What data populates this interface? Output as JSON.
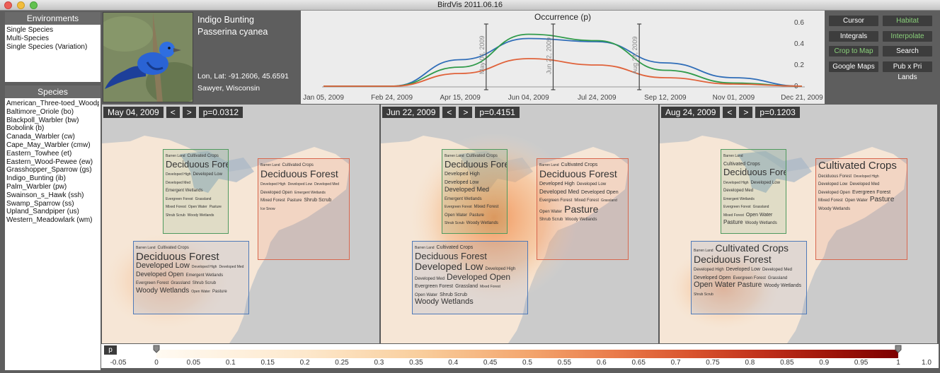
{
  "window": {
    "title": "BirdVis   2011.06.16"
  },
  "environments": {
    "header": "Environments",
    "items": [
      "Single Species",
      "Multi-Species",
      "Single Species (Variation)"
    ]
  },
  "species": {
    "header": "Species",
    "items": [
      "American_Three-toed_Woodp",
      "Baltimore_Oriole (bo)",
      "Blackpoll_Warbler (bw)",
      "Bobolink (b)",
      "Canada_Warbler (cw)",
      "Cape_May_Warbler (cmw)",
      "Eastern_Towhee (et)",
      "Eastern_Wood-Pewee (ew)",
      "Grasshopper_Sparrow (gs)",
      "Indigo_Bunting (ib)",
      "Palm_Warbler (pw)",
      "Swainson_s_Hawk (ssh)",
      "Swamp_Sparrow (ss)",
      "Upland_Sandpiper (us)",
      "Western_Meadowlark (wm)"
    ]
  },
  "bird": {
    "common_name": "Indigo Bunting",
    "latin_name": "Passerina cyanea",
    "coords": "Lon, Lat: -91.2606, 45.6591",
    "location": "Sawyer, Wisconsin"
  },
  "chart_data": {
    "type": "line",
    "title": "Occurrence (p)",
    "x": [
      "2009-01-05",
      "2009-02-24",
      "2009-04-15",
      "2009-06-04",
      "2009-07-24",
      "2009-09-12",
      "2009-11-01",
      "2009-12-21"
    ],
    "x_tick_labels": [
      "Jan 05, 2009",
      "Feb 24, 2009",
      "Apr 15, 2009",
      "Jun 04, 2009",
      "Jul 24, 2009",
      "Sep 12, 2009",
      "Nov 01, 2009",
      "Dec 21, 2009"
    ],
    "ylim": [
      0,
      0.6
    ],
    "y_ticks": [
      "0",
      "0.2",
      "0.4",
      "0.6"
    ],
    "series": [
      {
        "color": "#2f6db8",
        "values": [
          0.0,
          0.0,
          0.25,
          0.45,
          0.42,
          0.22,
          0.08,
          0.0
        ]
      },
      {
        "color": "#2f9a4a",
        "values": [
          0.0,
          0.0,
          0.18,
          0.49,
          0.43,
          0.15,
          0.03,
          0.0
        ]
      },
      {
        "color": "#e0623a",
        "values": [
          0.0,
          0.0,
          0.12,
          0.26,
          0.2,
          0.08,
          0.02,
          0.0
        ]
      }
    ],
    "markers": [
      {
        "x": "2009-05-04",
        "label": "May 04, 2009"
      },
      {
        "x": "2009-06-22",
        "label": "Jun 22, 2009"
      },
      {
        "x": "2009-08-24",
        "label": "Aug 24, 2009"
      }
    ]
  },
  "buttons": [
    {
      "label": "Cursor",
      "active": false
    },
    {
      "label": "Habitat",
      "active": true
    },
    {
      "label": "Integrals",
      "active": false
    },
    {
      "label": "Interpolate",
      "active": true
    },
    {
      "label": "Crop to Map",
      "active": true
    },
    {
      "label": "Search",
      "active": false
    },
    {
      "label": "Google Maps",
      "active": false
    },
    {
      "label": "Pub x Pri Lands",
      "active": false
    }
  ],
  "maps": [
    {
      "date": "May 04, 2009",
      "prev": "<",
      "next": ">",
      "p": "p=0.0312",
      "regions": [
        {
          "color": "#4f9a5e",
          "words": [
            [
              "Barren Land",
              5
            ],
            [
              "Cultivated Crops",
              6
            ],
            [
              "Deciduous Forest",
              13
            ],
            [
              "Developed High",
              5
            ],
            [
              "Developed Low",
              6
            ],
            [
              "Developed Med",
              5
            ],
            [
              "Emergent Wetlands",
              6
            ],
            [
              "Evergreen Forest",
              5
            ],
            [
              "Grassland",
              5
            ],
            [
              "Mixed Forest",
              5
            ],
            [
              "Open Water",
              5
            ],
            [
              "Pasture",
              5
            ],
            [
              "Shrub Scrub",
              5
            ],
            [
              "Woody Wetlands",
              5
            ]
          ]
        },
        {
          "color": "#d8674e",
          "words": [
            [
              "Barren Land",
              5
            ],
            [
              "Cultivated Crops",
              6
            ],
            [
              "Deciduous Forest",
              14
            ],
            [
              "Developed High",
              5
            ],
            [
              "Developed Low",
              5
            ],
            [
              "Developed Med",
              5
            ],
            [
              "Developed Open",
              6
            ],
            [
              "Emergent Wetlands",
              5
            ],
            [
              "Mixed Forest",
              6
            ],
            [
              "Pasture",
              6
            ],
            [
              "Shrub Scrub",
              7
            ],
            [
              "Ice Snow",
              5
            ]
          ]
        },
        {
          "color": "#4f7ab8",
          "words": [
            [
              "Barren Land",
              5
            ],
            [
              "Cultivated Crops",
              6
            ],
            [
              "Deciduous Forest",
              15
            ],
            [
              "Developed Low",
              11
            ],
            [
              "Developed High",
              5
            ],
            [
              "Developed Med",
              5
            ],
            [
              "Developed Open",
              9
            ],
            [
              "Emergent Wetlands",
              6
            ],
            [
              "Evergreen Forest",
              6
            ],
            [
              "Grassland",
              6
            ],
            [
              "Shrub Scrub",
              6
            ],
            [
              "Woody Wetlands",
              10
            ],
            [
              "Open Water",
              5
            ],
            [
              "Pasture",
              6
            ]
          ]
        }
      ]
    },
    {
      "date": "Jun 22, 2009",
      "prev": "<",
      "next": ">",
      "p": "p=0.4151",
      "regions": [
        {
          "color": "#4f9a5e",
          "words": [
            [
              "Barren Land",
              5
            ],
            [
              "Cultivated Crops",
              6
            ],
            [
              "Deciduous Forest",
              13
            ],
            [
              "Developed High",
              7
            ],
            [
              "Developed Low",
              7
            ],
            [
              "Developed Med",
              9
            ],
            [
              "Emergent Wetlands",
              6
            ],
            [
              "Evergreen Forest",
              5
            ],
            [
              "Mixed Forest",
              6
            ],
            [
              "Open Water",
              6
            ],
            [
              "Pasture",
              6
            ],
            [
              "Shrub Scrub",
              5
            ],
            [
              "Woody Wetlands",
              6
            ]
          ]
        },
        {
          "color": "#d8674e",
          "words": [
            [
              "Barren Land",
              5
            ],
            [
              "Cultivated Crops",
              7
            ],
            [
              "Deciduous Forest",
              14
            ],
            [
              "Developed High",
              7
            ],
            [
              "Developed Low",
              6
            ],
            [
              "Developed Med",
              8
            ],
            [
              "Developed Open",
              7
            ],
            [
              "Evergreen Forest",
              6
            ],
            [
              "Mixed Forest",
              6
            ],
            [
              "Grassland",
              5
            ],
            [
              "Open Water",
              6
            ],
            [
              "Pasture",
              14
            ],
            [
              "Shrub Scrub",
              6
            ],
            [
              "Woody Wetlands",
              6
            ]
          ]
        },
        {
          "color": "#4f7ab8",
          "words": [
            [
              "Barren Land",
              5
            ],
            [
              "Cultivated Crops",
              7
            ],
            [
              "Deciduous Forest",
              13
            ],
            [
              "Developed Low",
              14
            ],
            [
              "Developed High",
              6
            ],
            [
              "Developed Med",
              6
            ],
            [
              "Developed Open",
              12
            ],
            [
              "Evergreen Forest",
              7
            ],
            [
              "Grassland",
              7
            ],
            [
              "Mixed Forest",
              5
            ],
            [
              "Open Water",
              6
            ],
            [
              "Shrub Scrub",
              7
            ],
            [
              "Woody Wetlands",
              11
            ]
          ]
        }
      ]
    },
    {
      "date": "Aug 24, 2009",
      "prev": "<",
      "next": ">",
      "p": "p=0.1203",
      "regions": [
        {
          "color": "#4f9a5e",
          "words": [
            [
              "Barren Land",
              5
            ],
            [
              "Cultivated Crops",
              7
            ],
            [
              "Deciduous Forest",
              13
            ],
            [
              "Developed High",
              5
            ],
            [
              "Developed Low",
              6
            ],
            [
              "Developed Med",
              6
            ],
            [
              "Emergent Wetlands",
              5
            ],
            [
              "Evergreen Forest",
              5
            ],
            [
              "Grassland",
              5
            ],
            [
              "Mixed Forest",
              5
            ],
            [
              "Open Water",
              7
            ],
            [
              "Pasture",
              8
            ],
            [
              "Woody Wetlands",
              6
            ]
          ]
        },
        {
          "color": "#d8674e",
          "words": [
            [
              "Cultivated Crops",
              15
            ],
            [
              "Deciduous Forest",
              6
            ],
            [
              "Developed High",
              5
            ],
            [
              "Developed Low",
              6
            ],
            [
              "Developed Med",
              6
            ],
            [
              "Developed Open",
              6
            ],
            [
              "Evergreen Forest",
              7
            ],
            [
              "Mixed Forest",
              6
            ],
            [
              "Open Water",
              6
            ],
            [
              "Pasture",
              10
            ],
            [
              "Woody Wetlands",
              6
            ]
          ]
        },
        {
          "color": "#4f7ab8",
          "words": [
            [
              "Barren Land",
              5
            ],
            [
              "Cultivated Crops",
              14
            ],
            [
              "Deciduous Forest",
              14
            ],
            [
              "Developed High",
              6
            ],
            [
              "Developed Low",
              7
            ],
            [
              "Developed Med",
              6
            ],
            [
              "Developed Open",
              7
            ],
            [
              "Evergreen Forest",
              6
            ],
            [
              "Grassland",
              6
            ],
            [
              "Open Water",
              11
            ],
            [
              "Pasture",
              10
            ],
            [
              "Woody Wetlands",
              7
            ],
            [
              "Shrub Scrub",
              5
            ]
          ]
        }
      ]
    }
  ],
  "legend": {
    "label": "p",
    "ticks": [
      "-0.05",
      "0",
      "0.05",
      "0.1",
      "0.15",
      "0.2",
      "0.25",
      "0.3",
      "0.35",
      "0.4",
      "0.45",
      "0.5",
      "0.55",
      "0.6",
      "0.65",
      "0.7",
      "0.75",
      "0.8",
      "0.85",
      "0.9",
      "0.95",
      "1",
      "1.0"
    ]
  }
}
